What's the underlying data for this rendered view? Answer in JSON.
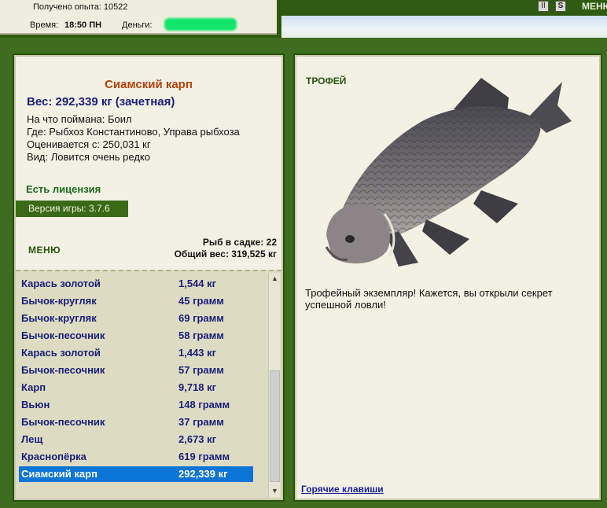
{
  "top": {
    "experience": "Получено опыта: 10522",
    "time_label": "Время:",
    "time_value": "18:50 ПН",
    "money_label": "Деньги:",
    "menu_label": "МЕНЮ"
  },
  "fish": {
    "name": "Сиамский карп",
    "weight": "Вес: 292,339 кг (зачетная)",
    "bait": "На что поймана: Боил",
    "location": "Где: Рыбхоз Константиново, Управа рыбхоза",
    "evaluated": "Оценивается с: 250,031 кг",
    "rarity": "Вид: Ловится очень редко"
  },
  "license": "Есть лицензия",
  "version": {
    "label": "Версия игры:",
    "value": "3.7.6"
  },
  "menu_label": "МЕНЮ",
  "keepnet": {
    "count": "Рыб в садке: 22",
    "total": "Общий вес: 319,525 кг"
  },
  "catch_list": [
    {
      "name": "Карась золотой",
      "weight": "1,544 кг"
    },
    {
      "name": "Бычок-кругляк",
      "weight": "45 грамм"
    },
    {
      "name": "Бычок-кругляк",
      "weight": "69 грамм"
    },
    {
      "name": "Бычок-песочник",
      "weight": "58 грамм"
    },
    {
      "name": "Карась золотой",
      "weight": "1,443 кг"
    },
    {
      "name": "Бычок-песочник",
      "weight": "57 грамм"
    },
    {
      "name": "Карп",
      "weight": "9,718 кг"
    },
    {
      "name": "Вьюн",
      "weight": "148 грамм"
    },
    {
      "name": "Бычок-песочник",
      "weight": "37 грамм"
    },
    {
      "name": "Лещ",
      "weight": "2,673 кг"
    },
    {
      "name": "Краснопёрка",
      "weight": "619 грамм"
    },
    {
      "name": "Сиамский карп",
      "weight": "292,339 кг"
    }
  ],
  "selected_index": 11,
  "trophy": {
    "title": "ТРОФЕЙ",
    "text": "Трофейный экземпляр! Кажется, вы открыли секрет успешной ловли!"
  },
  "hotkeys_label": "Горячие клавиши",
  "colors": {
    "frame": "#3f6d1f",
    "panel": "#f2f1e4",
    "selection": "#0a75d6",
    "fish_title": "#b3410c",
    "list_text": "#1a1f7a"
  }
}
